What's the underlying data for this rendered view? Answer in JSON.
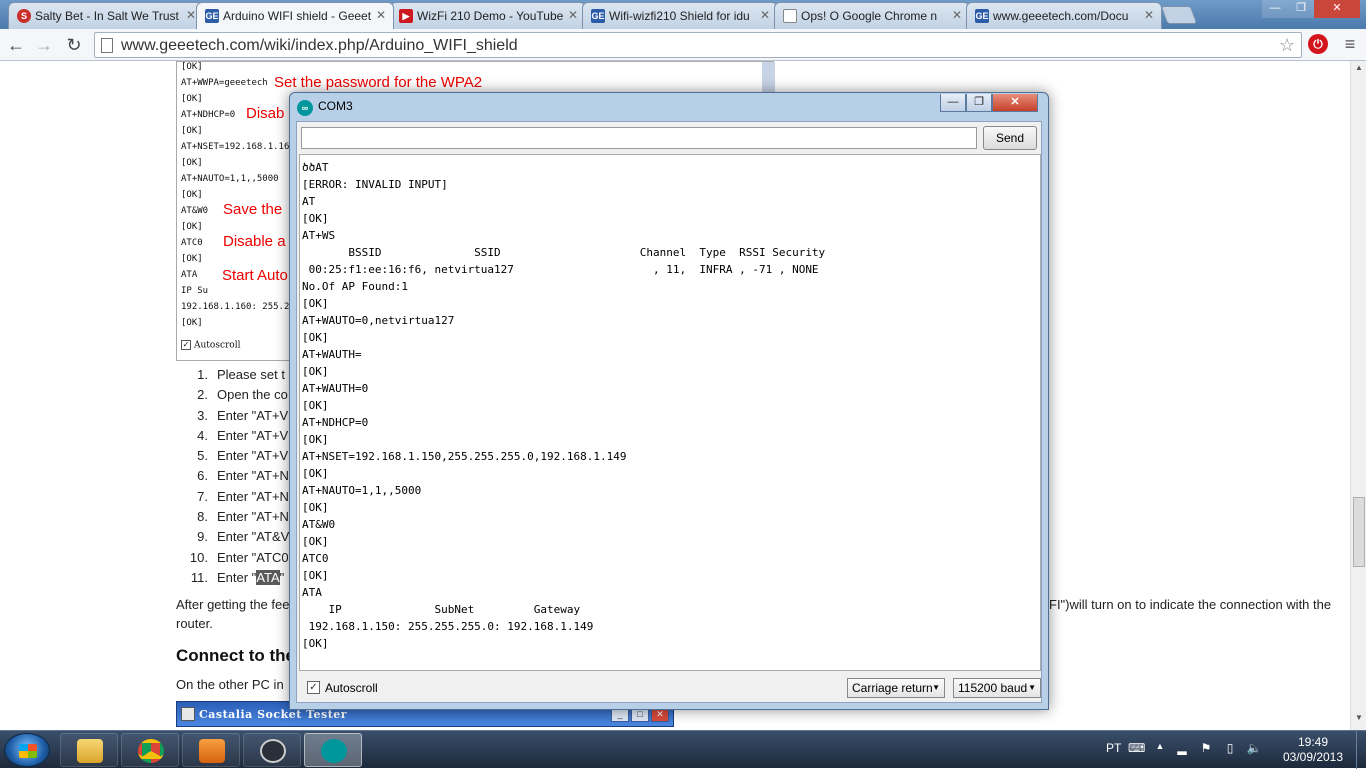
{
  "browser": {
    "tabs": [
      {
        "title": "Salty Bet - In Salt We Trust",
        "favicon": "S"
      },
      {
        "title": "Arduino WIFI shield - Geeetech",
        "favicon": "GE"
      },
      {
        "title": "WizFi 210 Demo - YouTube",
        "favicon": "▶"
      },
      {
        "title": "Wifi-wizfi210 Shield for idu",
        "favicon": "GE"
      },
      {
        "title": "Ops! O Google Chrome n",
        "favicon": ""
      },
      {
        "title": "www.geeetech.com/Docu",
        "favicon": "GE"
      }
    ],
    "url": "www.geeetech.com/wiki/index.php/Arduino_WIFI_shield",
    "window_controls": {
      "minimize": "—",
      "maximize": "❐",
      "close": "✕"
    }
  },
  "page": {
    "image_console": [
      "[OK]",
      "AT+WWPA=geeetech",
      "[OK]",
      "AT+NDHCP=0",
      "[OK]",
      "AT+NSET=192.168.1.160,",
      "[OK]",
      "AT+NAUTO=1,1,,5000",
      "[OK]",
      "AT&W0",
      "[OK]",
      "ATC0",
      "[OK]",
      "ATA",
      "    IP              Su",
      " 192.168.1.160: 255.2",
      "[OK]"
    ],
    "image_annotations": [
      "Set the password for the WPA2",
      "Disab",
      "Save the",
      "Disable a",
      "Start Auto"
    ],
    "image_autoscroll": "Autoscroll",
    "steps": [
      {
        "num": "1.",
        "pre": "Please set t",
        "hl": "",
        "post": ""
      },
      {
        "num": "2.",
        "pre": "Open the co",
        "hl": "",
        "post": ""
      },
      {
        "num": "3.",
        "pre": "Enter \"AT+V",
        "hl": "",
        "post": ""
      },
      {
        "num": "4.",
        "pre": "Enter \"AT+V",
        "hl": "",
        "post": ""
      },
      {
        "num": "5.",
        "pre": "Enter \"AT+V",
        "hl": "",
        "post": ""
      },
      {
        "num": "6.",
        "pre": "Enter \"AT+N",
        "hl": "",
        "post": ""
      },
      {
        "num": "7.",
        "pre": "Enter \"AT+N",
        "hl": "",
        "post": ""
      },
      {
        "num": "8.",
        "pre": "Enter \"AT+N",
        "hl": "",
        "post": ""
      },
      {
        "num": "9.",
        "pre": "Enter \"AT&V",
        "hl": "",
        "post": ""
      },
      {
        "num": "10.",
        "pre": "Enter \"ATC0",
        "hl": "",
        "post": ""
      },
      {
        "num": "11.",
        "pre": "Enter \"",
        "hl": "ATA",
        "post": "\""
      }
    ],
    "para_left": "After getting the fee",
    "para_right": "FI\")will turn on to indicate the connection with the",
    "para_end": "router.",
    "heading": "Connect to the",
    "para2": "On the other PC in",
    "castalia_title": "Castalia Socket Tester"
  },
  "com3": {
    "title": "COM3",
    "input_value": "",
    "send_label": "Send",
    "lines": [
      "ծծAT",
      "[ERROR: INVALID INPUT]",
      "AT",
      "[OK]",
      "AT+WS",
      "       BSSID              SSID                     Channel  Type  RSSI Security",
      " 00:25:f1:ee:16:f6, netvirtua127                     , 11,  INFRA , -71 , NONE",
      "No.Of AP Found:1",
      "[OK]",
      "AT+WAUTO=0,netvirtua127",
      "[OK]",
      "AT+WAUTH=",
      "[OK]",
      "AT+WAUTH=0",
      "[OK]",
      "AT+NDHCP=0",
      "[OK]",
      "AT+NSET=192.168.1.150,255.255.255.0,192.168.1.149",
      "[OK]",
      "AT+NAUTO=1,1,,5000",
      "[OK]",
      "AT&W0",
      "[OK]",
      "ATC0",
      "[OK]",
      "ATA",
      "    IP              SubNet         Gateway",
      " 192.168.1.150: 255.255.255.0: 192.168.1.149",
      "[OK]"
    ],
    "autoscroll_label": "Autoscroll",
    "autoscroll_checked": true,
    "line_ending": "Carriage return",
    "baud": "115200 baud"
  },
  "taskbar": {
    "language": "PT",
    "time": "19:49",
    "date": "03/09/2013"
  },
  "colors": {
    "accent_red": "#e00000",
    "arduino_teal": "#00979c"
  }
}
